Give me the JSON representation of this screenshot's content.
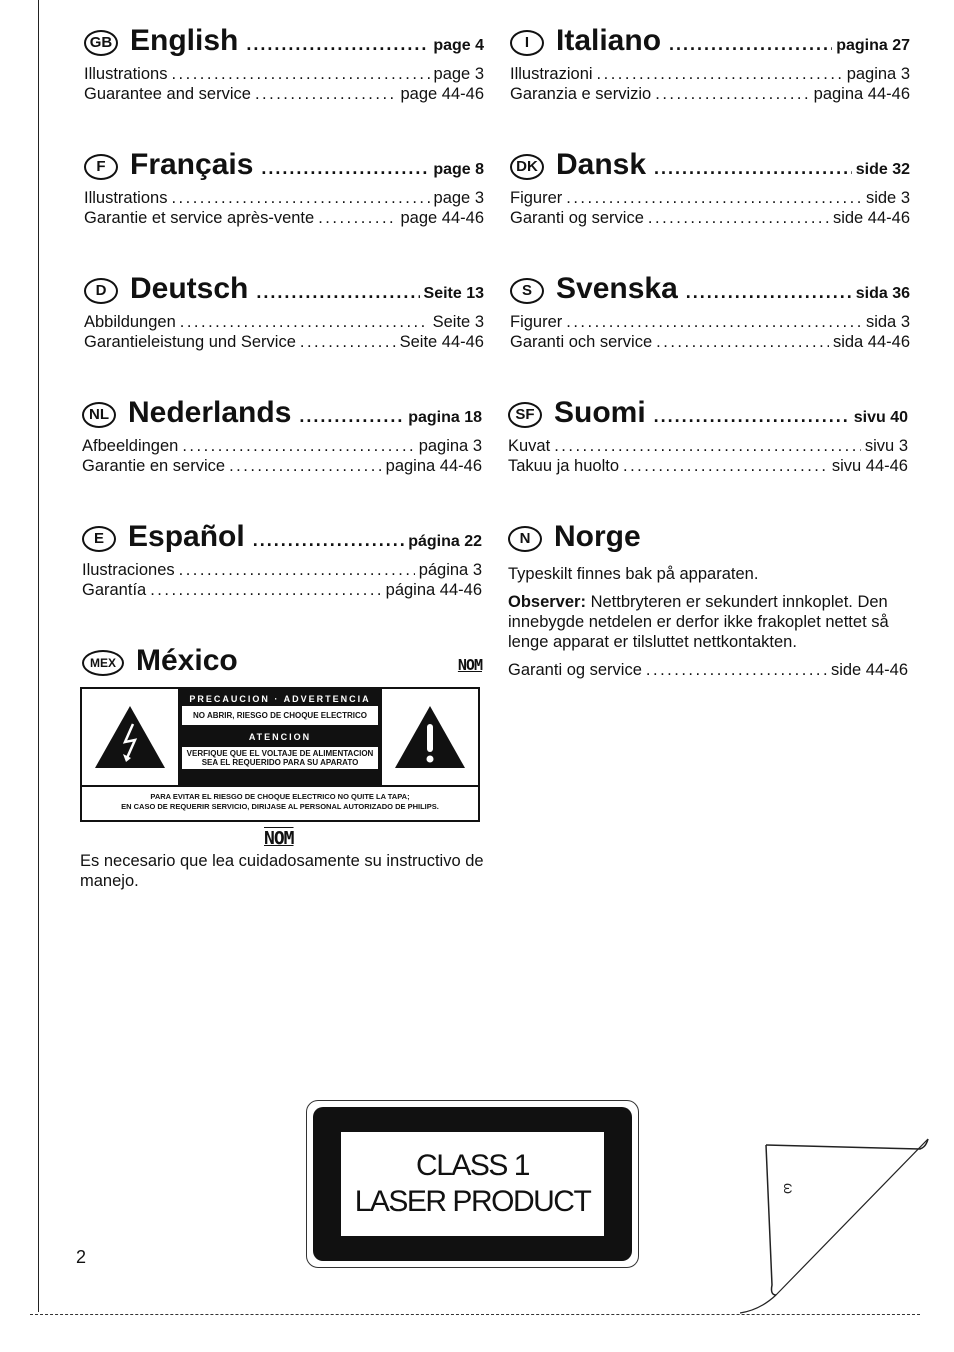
{
  "sections": {
    "english": {
      "badge": "GB",
      "title": "English",
      "page": "page 4",
      "rows": [
        {
          "label": "Illustrations",
          "page": "page 3"
        },
        {
          "label": "Guarantee and service",
          "page": "page 44-46"
        }
      ]
    },
    "italiano": {
      "badge": "I",
      "title": "Italiano",
      "page": "pagina 27",
      "rows": [
        {
          "label": "Illustrazioni",
          "page": "pagina 3"
        },
        {
          "label": "Garanzia e servizio",
          "page": "pagina 44-46"
        }
      ]
    },
    "francais": {
      "badge": "F",
      "title": "Français",
      "page": "page 8",
      "rows": [
        {
          "label": "Illustrations",
          "page": "page 3"
        },
        {
          "label": "Garantie et service après-vente",
          "page": "page 44-46"
        }
      ]
    },
    "dansk": {
      "badge": "DK",
      "title": "Dansk",
      "page": "side 32",
      "rows": [
        {
          "label": "Figurer",
          "page": "side 3"
        },
        {
          "label": "Garanti og service",
          "page": "side 44-46"
        }
      ]
    },
    "deutsch": {
      "badge": "D",
      "title": "Deutsch",
      "page": "Seite 13",
      "rows": [
        {
          "label": "Abbildungen",
          "page": "Seite 3"
        },
        {
          "label": "Garantieleistung und Service",
          "page": "Seite 44-46"
        }
      ]
    },
    "svenska": {
      "badge": "S",
      "title": "Svenska",
      "page": "sida 36",
      "rows": [
        {
          "label": "Figurer",
          "page": "sida 3"
        },
        {
          "label": "Garanti och service",
          "page": "sida 44-46"
        }
      ]
    },
    "nederlands": {
      "badge": "NL",
      "title": "Nederlands",
      "page": "pagina 18",
      "rows": [
        {
          "label": "Afbeeldingen",
          "page": "pagina 3"
        },
        {
          "label": "Garantie en service",
          "page": "pagina 44-46"
        }
      ]
    },
    "suomi": {
      "badge": "SF",
      "title": "Suomi",
      "page": "sivu 40",
      "rows": [
        {
          "label": "Kuvat",
          "page": "sivu 3"
        },
        {
          "label": "Takuu ja huolto",
          "page": "sivu 44-46"
        }
      ]
    },
    "espanol": {
      "badge": "E",
      "title": "Español",
      "page": "página 22",
      "rows": [
        {
          "label": "Ilustraciones",
          "page": "página 3"
        },
        {
          "label": "Garantía",
          "page": "página 44-46"
        }
      ]
    },
    "norge": {
      "badge": "N",
      "title": "Norge",
      "line1": "Typeskilt finnes bak på apparaten.",
      "observer_label": "Observer:",
      "observer_text": "Nettbryteren er sekundert innkoplet. Den innebygde netdelen er derfor ikke frakoplet nettet så lenge apparat er tilsluttet nettkontakten.",
      "rows": [
        {
          "label": "Garanti og service",
          "page": "side 44-46"
        }
      ]
    },
    "mexico": {
      "badge": "MEX",
      "title": "México",
      "nom": "NOM",
      "warning": {
        "header1": "PRECAUCION · ADVERTENCIA",
        "box1": "NO ABRIR, RIESGO DE CHOQUE ELECTRICO",
        "header2": "ATENCION",
        "box2_line1": "VERFIQUE QUE EL VOLTAJE DE ALIMENTACION",
        "box2_line2": "SEA EL REQUERIDO PARA SU APARATO",
        "bottom_line1": "PARA EVITAR EL RIESGO DE CHOQUE ELECTRICO NO QUITE LA TAPA;",
        "bottom_line2": "EN CASO DE REQUERIR SERVICIO, DIRIJASE AL PERSONAL AUTORIZADO DE PHILIPS."
      },
      "nom_bottom": "NOM",
      "note": "Es necesario que lea cuidadosamente su instructivo de manejo."
    }
  },
  "laser_label": {
    "line1": "CLASS 1",
    "line2": "LASER PRODUCT"
  },
  "corner_symbol": "ω",
  "page_number": "2",
  "dots": "....................................................................................."
}
